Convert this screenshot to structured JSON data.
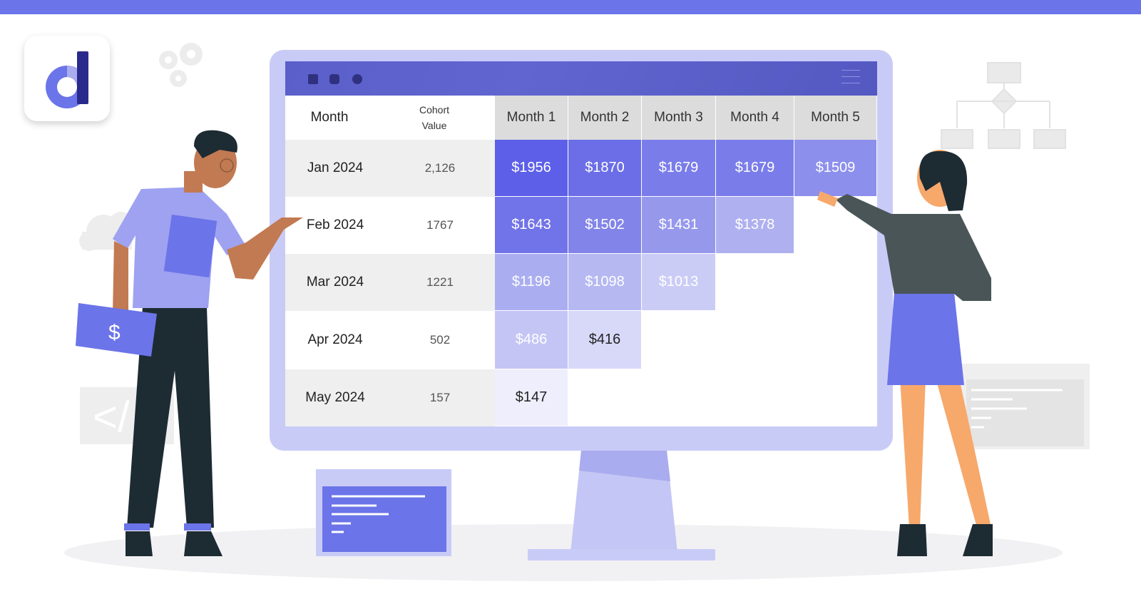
{
  "brand": {
    "logo_letter": "d",
    "accent": "#6b74e8"
  },
  "table": {
    "headers": {
      "month": "Month",
      "cohort_value": [
        "Cohort",
        "Value"
      ],
      "months": [
        "Month 1",
        "Month 2",
        "Month 3",
        "Month 4",
        "Month 5"
      ]
    },
    "rows": [
      {
        "month": "Jan 2024",
        "cohort_value": "2,126",
        "values": [
          "$1956",
          "$1870",
          "$1679",
          "$1679",
          "$1509"
        ]
      },
      {
        "month": "Feb 2024",
        "cohort_value": "1767",
        "values": [
          "$1643",
          "$1502",
          "$1431",
          "$1378"
        ]
      },
      {
        "month": "Mar 2024",
        "cohort_value": "1221",
        "values": [
          "$1196",
          "$1098",
          "$1013"
        ]
      },
      {
        "month": "Apr 2024",
        "cohort_value": "502",
        "values": [
          "$486",
          "$416"
        ]
      },
      {
        "month": "May 2024",
        "cohort_value": "157",
        "values": [
          "$147"
        ]
      }
    ],
    "cell_colors": [
      [
        "#5d5fe8",
        "#6b6ee6",
        "#7a7de9",
        "#7a7de9",
        "#8c8fec"
      ],
      [
        "#7173e8",
        "#8284e9",
        "#9698ec",
        "#aeb0f0"
      ],
      [
        "#abadf1",
        "#b6b8f2",
        "#cbccf6"
      ],
      [
        "#c4c5f5",
        "#d8d9f9"
      ],
      [
        "#eeeefd"
      ]
    ]
  },
  "illustration": {
    "dollar_sign": "$",
    "code_tag": "</"
  }
}
